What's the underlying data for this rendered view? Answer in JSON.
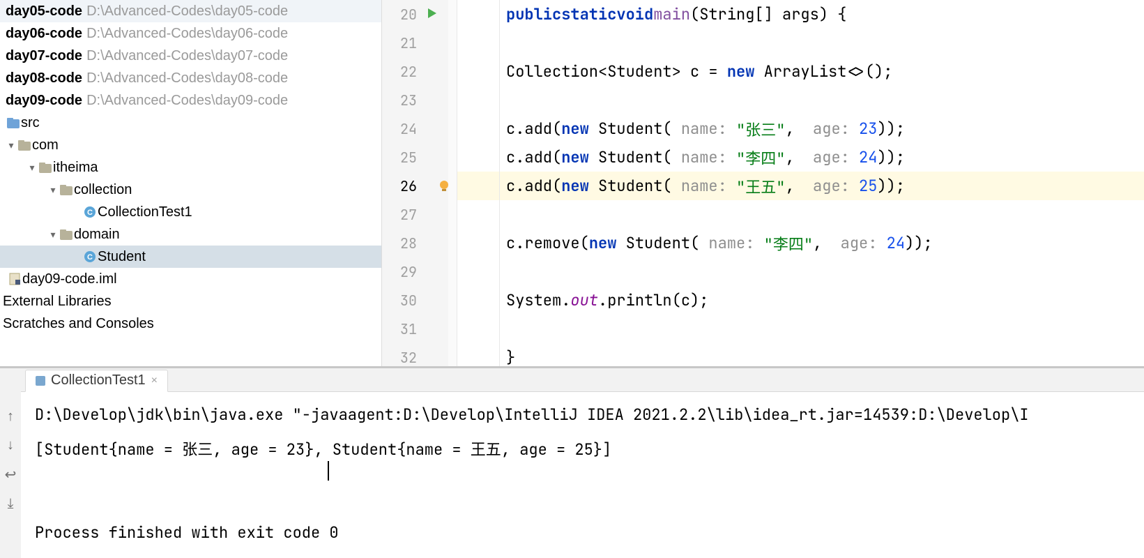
{
  "sidebar": {
    "projects": [
      {
        "name": "day05-code",
        "path": "D:\\Advanced-Codes\\day05-code"
      },
      {
        "name": "day06-code",
        "path": "D:\\Advanced-Codes\\day06-code"
      },
      {
        "name": "day07-code",
        "path": "D:\\Advanced-Codes\\day07-code"
      },
      {
        "name": "day08-code",
        "path": "D:\\Advanced-Codes\\day08-code"
      },
      {
        "name": "day09-code",
        "path": "D:\\Advanced-Codes\\day09-code"
      }
    ],
    "src_label": "src",
    "pkg_com": "com",
    "pkg_itheima": "itheima",
    "pkg_collection": "collection",
    "file_collectionTest1": "CollectionTest1",
    "pkg_domain": "domain",
    "file_student": "Student",
    "iml": "day09-code.iml",
    "external": "External Libraries",
    "scratches": "Scratches and Consoles"
  },
  "editor": {
    "line_numbers": [
      "20",
      "21",
      "22",
      "23",
      "24",
      "25",
      "26",
      "27",
      "28",
      "29",
      "30",
      "31",
      "32"
    ],
    "tokens": {
      "public": "public",
      "static": "static",
      "void": "void",
      "main": "main",
      "params": "(String[] args) {",
      "collection_decl": "Collection<Student> c = ",
      "new": "new",
      " array": " ArrayList<>();",
      "addPrefix": "c.add(",
      "student": " Student(",
      "name_hint": " name: ",
      "age_hint": "  age: ",
      "name1": "\"张三\"",
      "age1": "23",
      "name2": "\"李四\"",
      "age2": "24",
      "name3": "\"王五\"",
      "age3": "25",
      "remove": "c.remove(",
      "name4": "\"李四\"",
      "age4": "24",
      "print_pre": "System.",
      "out": "out",
      "print_post": ".println(c);",
      "closebrace": "}",
      "comma": ",",
      "close": "));"
    }
  },
  "run": {
    "tab": "CollectionTest1",
    "cmd": "D:\\Develop\\jdk\\bin\\java.exe \"-javaagent:D:\\Develop\\IntelliJ IDEA 2021.2.2\\lib\\idea_rt.jar=14539:D:\\Develop\\I",
    "output": "[Student{name = 张三, age = 23}, Student{name = 王五, age = 25}]",
    "exit": "Process finished with exit code 0"
  },
  "icons": {
    "chevron_down": "▾",
    "chevron_right": "▸",
    "folder": "folder",
    "class": "C",
    "src": "src"
  }
}
